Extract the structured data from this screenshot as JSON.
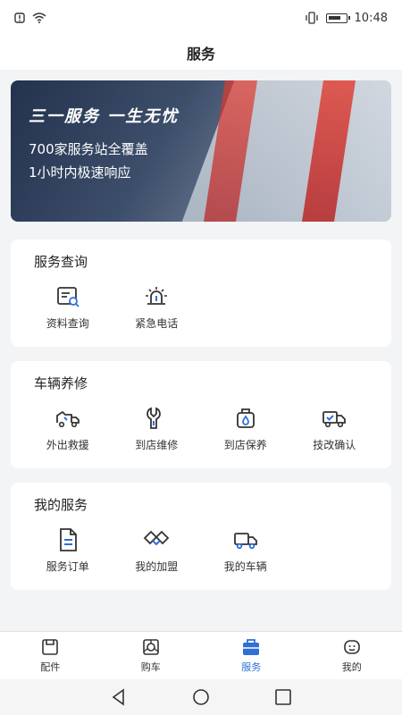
{
  "status": {
    "time": "10:48",
    "left_icons": [
      "alert-icon",
      "wifi-icon"
    ],
    "right_icons": [
      "vibrate-icon",
      "battery-icon"
    ]
  },
  "header": {
    "title": "服务"
  },
  "banner": {
    "slogan": "三一服务 一生无忧",
    "line1": "700家服务站全覆盖",
    "line2": "1小时内极速响应"
  },
  "sections": {
    "query": {
      "title": "服务查询",
      "items": [
        {
          "label": "资料查询",
          "icon": "document-search-icon"
        },
        {
          "label": "紧急电话",
          "icon": "alarm-light-icon"
        }
      ]
    },
    "maintenance": {
      "title": "车辆养修",
      "items": [
        {
          "label": "外出救援",
          "icon": "rescue-truck-icon"
        },
        {
          "label": "到店维修",
          "icon": "wrench-icon"
        },
        {
          "label": "到店保养",
          "icon": "oil-drop-icon"
        },
        {
          "label": "技改确认",
          "icon": "truck-check-icon"
        }
      ]
    },
    "mine": {
      "title": "我的服务",
      "items": [
        {
          "label": "服务订单",
          "icon": "order-document-icon"
        },
        {
          "label": "我的加盟",
          "icon": "handshake-icon"
        },
        {
          "label": "我的车辆",
          "icon": "truck-icon"
        }
      ]
    }
  },
  "tabs": [
    {
      "label": "配件",
      "icon": "parts-icon",
      "active": false
    },
    {
      "label": "购车",
      "icon": "buy-car-icon",
      "active": false
    },
    {
      "label": "服务",
      "icon": "service-bag-icon",
      "active": true
    },
    {
      "label": "我的",
      "icon": "profile-face-icon",
      "active": false
    }
  ],
  "colors": {
    "accent": "#2f6fd8",
    "icon_stroke": "#333333",
    "icon_accent": "#2f6fd8"
  }
}
